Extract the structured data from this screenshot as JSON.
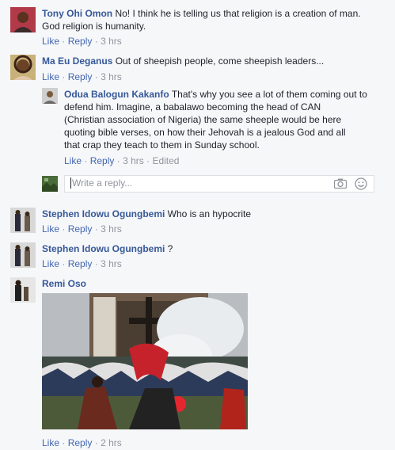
{
  "comments": [
    {
      "name": "Tony Ohi Omon",
      "line1": "No! I think he is telling us that religion is a creation of man.",
      "line2": "God religion is humanity.",
      "like": "Like",
      "reply": "Reply",
      "time": "3 hrs"
    },
    {
      "name": "Ma Eu Deganus",
      "line1": "Out of sheepish people, come sheepish leaders...",
      "like": "Like",
      "reply": "Reply",
      "time": "3 hrs"
    },
    {
      "name": "Stephen Idowu Ogungbemi",
      "line1": "Who is an hypocrite",
      "like": "Like",
      "reply": "Reply",
      "time": "3 hrs"
    },
    {
      "name": "Stephen Idowu Ogungbemi",
      "line1": "?",
      "like": "Like",
      "reply": "Reply",
      "time": "3 hrs"
    },
    {
      "name": "Remi Oso",
      "like": "Like",
      "reply": "Reply",
      "time": "2 hrs"
    }
  ],
  "nested_reply": {
    "name": "Odua Balogun Kakanfo",
    "line1": "That's why you see a lot of them coming out to",
    "line2": "defend him. Imagine, a babalawo becoming the head of CAN",
    "line3": "(Christian association of Nigeria) the same sheeple would be here",
    "line4": "quoting bible verses, on how their Jehovah is a jealous God and all",
    "line5": "that crap they teach to them in Sunday school.",
    "like": "Like",
    "reply": "Reply",
    "time": "3 hrs",
    "edited": "Edited"
  },
  "reply_box": {
    "placeholder": "Write a reply..."
  },
  "icons": {
    "camera": "camera-icon",
    "emoji": "smiley-icon"
  },
  "colors": {
    "name_link": "#365899",
    "action_link": "#4267b2",
    "meta": "#90949c",
    "background": "#f6f7f9"
  }
}
